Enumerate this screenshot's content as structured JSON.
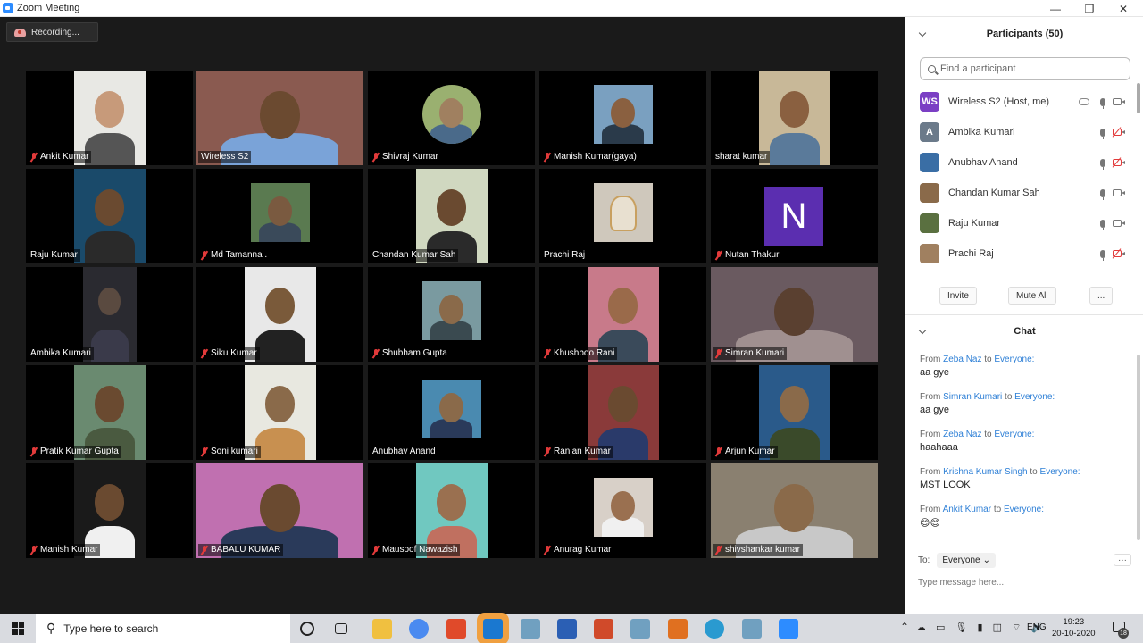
{
  "window": {
    "title": "Zoom Meeting",
    "minimize_label": "—",
    "maximize_label": "❐",
    "close_label": "✕"
  },
  "meeting": {
    "recording_label": "Recording...",
    "tiles": [
      {
        "name": "Ankit Kumar",
        "muted": true
      },
      {
        "name": "Wireless S2",
        "muted": false,
        "active": true
      },
      {
        "name": "Shivraj Kumar",
        "muted": true
      },
      {
        "name": "Manish Kumar(gaya)",
        "muted": true
      },
      {
        "name": "sharat kumar",
        "muted": false
      },
      {
        "name": "Raju Kumar",
        "muted": false
      },
      {
        "name": "Md Tamanna .",
        "muted": true
      },
      {
        "name": "Chandan Kumar Sah",
        "muted": false
      },
      {
        "name": "Prachi Raj",
        "muted": false
      },
      {
        "name": "Nutan Thakur",
        "muted": true,
        "avatar_letter": "N"
      },
      {
        "name": "Ambika Kumari",
        "muted": false
      },
      {
        "name": "Siku Kumar",
        "muted": true
      },
      {
        "name": "Shubham Gupta",
        "muted": true
      },
      {
        "name": "Khushboo Rani",
        "muted": true
      },
      {
        "name": "Simran Kumari",
        "muted": true
      },
      {
        "name": "Pratik Kumar Gupta",
        "muted": true
      },
      {
        "name": "Soni kumari",
        "muted": true
      },
      {
        "name": "Anubhav Anand",
        "muted": false
      },
      {
        "name": "Ranjan Kumar",
        "muted": true
      },
      {
        "name": "Arjun Kumar",
        "muted": true
      },
      {
        "name": "Manish Kumar",
        "muted": true
      },
      {
        "name": "BABALU KUMAR",
        "muted": true
      },
      {
        "name": "Mausoof Nawazish",
        "muted": true
      },
      {
        "name": "Anurag Kumar",
        "muted": true
      },
      {
        "name": "shivshankar kumar",
        "muted": true
      }
    ]
  },
  "participants": {
    "title": "Participants (50)",
    "search_placeholder": "Find a participant",
    "list": [
      {
        "name": "Wireless S2 (Host, me)",
        "avatar": "WS",
        "avatar_color": "#7b3fc4",
        "cam_off": false,
        "host": true
      },
      {
        "name": "Ambika Kumari",
        "avatar": "A",
        "avatar_color": "#6b7a8a",
        "cam_off": true
      },
      {
        "name": "Anubhav Anand",
        "avatar": "",
        "avatar_color": "#3a6ea5",
        "cam_off": true
      },
      {
        "name": "Chandan Kumar Sah",
        "avatar": "",
        "avatar_color": "#8a6a4a",
        "cam_off": false
      },
      {
        "name": "Raju Kumar",
        "avatar": "",
        "avatar_color": "#5a7040",
        "cam_off": false
      },
      {
        "name": "Prachi Raj",
        "avatar": "",
        "avatar_color": "#a08060",
        "cam_off": true
      }
    ],
    "invite_label": "Invite",
    "mute_all_label": "Mute All",
    "more_label": "..."
  },
  "chat": {
    "title": "Chat",
    "from_label": "From",
    "to_word": "to",
    "messages": [
      {
        "from": "Zeba Naz",
        "to": "Everyone:",
        "text": "aa gye"
      },
      {
        "from": "Simran Kumari",
        "to": "Everyone:",
        "text": "aa gye"
      },
      {
        "from": "Zeba Naz",
        "to": "Everyone:",
        "text": "haahaaa"
      },
      {
        "from": "Krishna Kumar Singh",
        "to": "Everyone:",
        "text": "MST LOOK"
      },
      {
        "from": "Ankit Kumar",
        "to": "Everyone:",
        "text": "😊😊"
      }
    ],
    "to_label": "To:",
    "to_value": "Everyone",
    "more_label": "···",
    "input_placeholder": "Type message here..."
  },
  "taskbar": {
    "search_placeholder": "Type here to search",
    "language": "ENG",
    "time": "19:23",
    "date": "20-10-2020",
    "notification_count": "18",
    "icons": [
      "cortana-icon",
      "task-view-icon",
      "file-explorer-icon",
      "chrome-icon",
      "office-icon",
      "app-icon",
      "app-icon",
      "word-icon",
      "powerpoint-icon",
      "app-icon",
      "matlab-icon",
      "edge-icon",
      "app-icon",
      "zoom-icon"
    ]
  }
}
